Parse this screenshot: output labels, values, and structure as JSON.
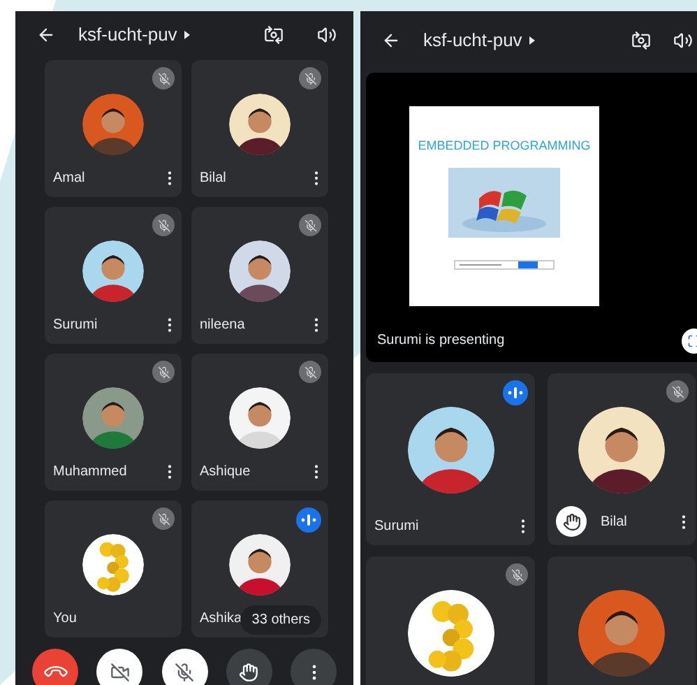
{
  "phones": [
    {
      "kind": "grid",
      "title": "ksf-ucht-puv",
      "camera_on": false,
      "mic_on": false,
      "tiles": [
        {
          "name": "Amal",
          "muted": true,
          "speaking": false,
          "hand_raised": false,
          "menu": true
        },
        {
          "name": "Bilal",
          "muted": true,
          "speaking": false,
          "hand_raised": false,
          "menu": true
        },
        {
          "name": "Surumi",
          "muted": true,
          "speaking": false,
          "hand_raised": false,
          "menu": true
        },
        {
          "name": "nileena",
          "muted": true,
          "speaking": false,
          "hand_raised": false,
          "menu": true
        },
        {
          "name": "Muhammed",
          "muted": true,
          "speaking": false,
          "hand_raised": false,
          "menu": true
        },
        {
          "name": "Ashique",
          "muted": true,
          "speaking": false,
          "hand_raised": false,
          "menu": true
        },
        {
          "name": "You",
          "muted": true,
          "speaking": false,
          "hand_raised": false,
          "menu": false
        },
        {
          "name": "Ashika",
          "speaking": true,
          "hand_raised": false,
          "menu": false,
          "badge": "33 others"
        }
      ]
    },
    {
      "kind": "presenting",
      "title": "ksf-ucht-puv",
      "slide_title": "EMBEDDED PROGRAMMING",
      "caption": "Surumi is presenting",
      "tiles": [
        {
          "name": "Surumi",
          "speaking": true,
          "hand_raised": false,
          "menu": true
        },
        {
          "name": "Bilal",
          "muted": true,
          "speaking": false,
          "hand_raised": true,
          "menu": true
        },
        {
          "muted": true,
          "speaking": false
        },
        {
          "muted": false,
          "speaking": false
        }
      ]
    }
  ]
}
